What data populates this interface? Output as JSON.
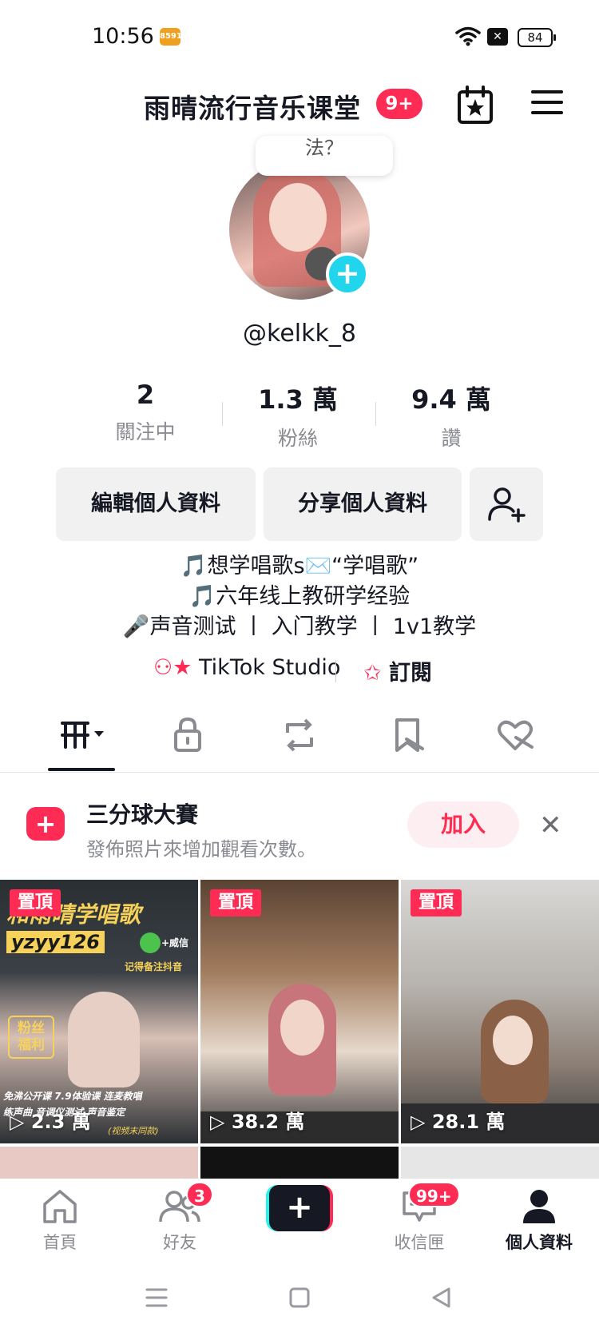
{
  "status_bar": {
    "time": "10:56",
    "battery": "84",
    "app_badge": "8591"
  },
  "header": {
    "title": "雨晴流行音乐课堂",
    "badge": "9+"
  },
  "profile": {
    "bubble_text": "法？",
    "handle": "@kelkk_8",
    "stats": [
      {
        "value": "2",
        "label": "關注中"
      },
      {
        "value": "1.3 萬",
        "label": "粉絲"
      },
      {
        "value": "9.4 萬",
        "label": "讚"
      }
    ],
    "buttons": {
      "edit": "編輯個人資料",
      "share": "分享個人資料"
    },
    "bio": [
      "🎵想学唱歌s✉️“学唱歌”",
      "🎵六年线上教研学经验",
      "🎤声音测试 丨 入门教学 丨 1v1教学"
    ],
    "links": {
      "studio": "TikTok Studio",
      "subscribe": "訂閱"
    }
  },
  "promo": {
    "title": "三分球大賽",
    "subtitle": "發佈照片來增加觀看次數。",
    "join": "加入"
  },
  "videos": [
    {
      "pin": "置頂",
      "views": "2.3 萬",
      "overlay_lines": [
        "和雨晴学唱歌",
        "yzyy126",
        "记得备注抖音",
        "粉丝福利",
        "免沸公开课 7.9体验课 连麦教唱",
        "练声曲 音调仪测试 声音鉴定",
        "(视频末同款)"
      ],
      "wechat_label": "+威信"
    },
    {
      "pin": "置頂",
      "views": "38.2 萬"
    },
    {
      "pin": "置頂",
      "views": "28.1 萬"
    }
  ],
  "bottom_nav": {
    "items": [
      {
        "label": "首頁"
      },
      {
        "label": "好友",
        "badge": "3"
      },
      {
        "label": "收信匣",
        "badge": "99+"
      },
      {
        "label": "個人資料"
      }
    ]
  },
  "colors": {
    "accent": "#fe2c55",
    "cyan": "#25f4ee",
    "text": "#161823",
    "muted": "#8a8b91"
  }
}
